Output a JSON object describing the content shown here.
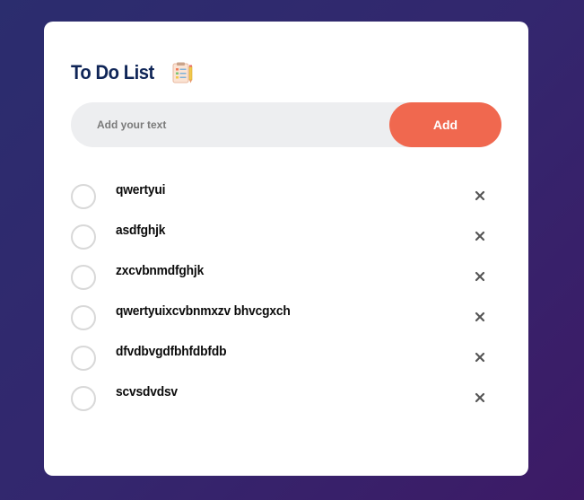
{
  "app": {
    "title": "To Do List",
    "title_icon": "notepad-checklist-icon"
  },
  "input": {
    "value": "",
    "placeholder": "Add your text"
  },
  "add_button": {
    "label": "Add"
  },
  "colors": {
    "title": "#0f2557",
    "accent": "#f0684f",
    "input_bg": "#edeef0",
    "check_border": "#d8d8d8",
    "delete_icon": "#555555"
  },
  "tasks": [
    {
      "text": "qwertyui",
      "done": false
    },
    {
      "text": "asdfghjk",
      "done": false
    },
    {
      "text": "zxcvbnmdfghjk",
      "done": false
    },
    {
      "text": "qwertyuixcvbnmxzv bhvcgxch",
      "done": false
    },
    {
      "text": "dfvdbvgdfbhfdbfdb",
      "done": false
    },
    {
      "text": "scvsdvdsv",
      "done": false
    }
  ],
  "icons": {
    "check": "circle-checkbox-icon",
    "delete": "close-icon"
  }
}
